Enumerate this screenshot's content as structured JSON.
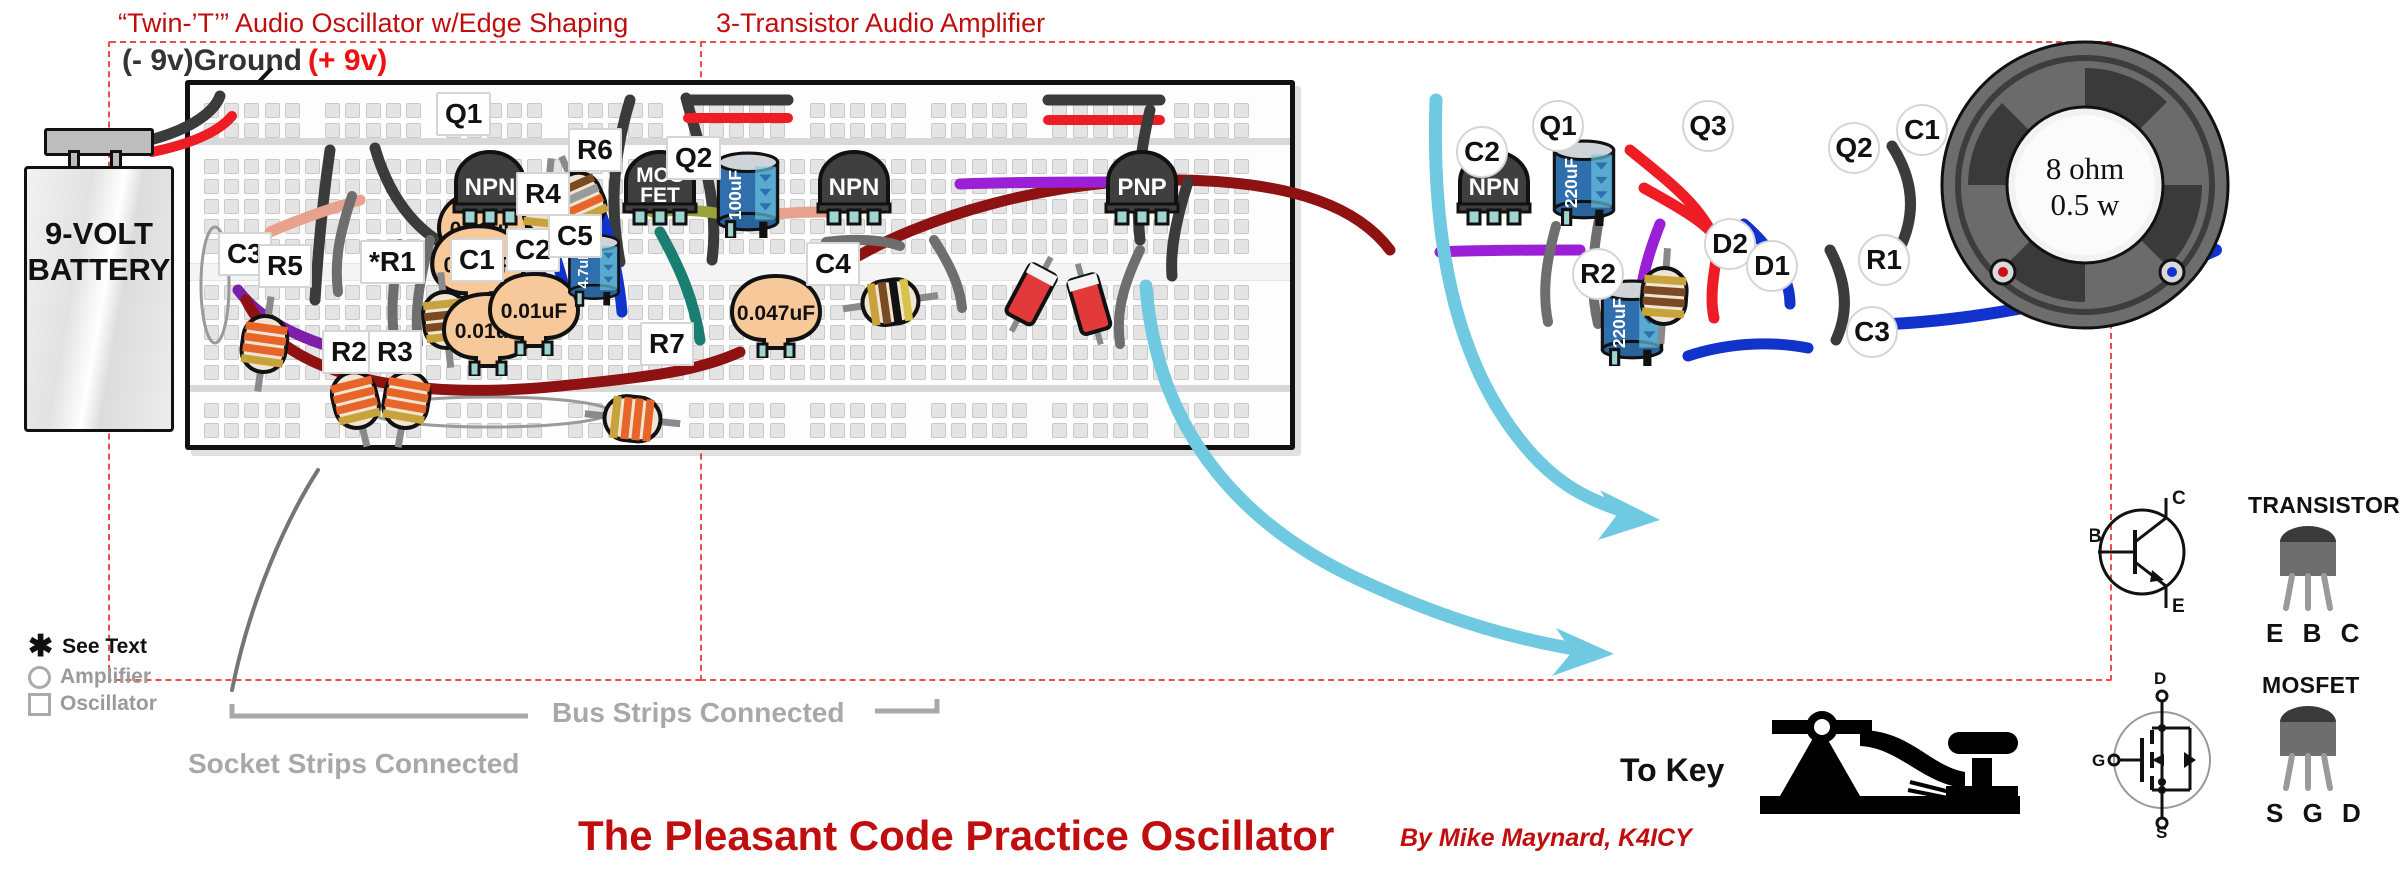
{
  "headings": {
    "oscillator_section": "“Twin-’T’” Audio Oscillator w/Edge Shaping",
    "amplifier_section": "3-Transistor Audio Amplifier",
    "ground_label": "(- 9v)Ground",
    "plus9_label": "(+ 9v)"
  },
  "battery": {
    "line1": "9-VOLT",
    "line2": "BATTERY"
  },
  "speaker": {
    "line1": "8 ohm",
    "line2": "0.5 w"
  },
  "oscillator_parts": [
    {
      "tag": "C3",
      "shape": "square"
    },
    {
      "tag": "Q1",
      "shape": "square"
    },
    {
      "tag": "R6",
      "shape": "square"
    },
    {
      "tag": "R4",
      "shape": "square"
    },
    {
      "tag": "Q2",
      "shape": "square"
    },
    {
      "tag": "R5",
      "shape": "square"
    },
    {
      "tag": "*R1",
      "shape": "square"
    },
    {
      "tag": "C1",
      "shape": "square"
    },
    {
      "tag": "C2",
      "shape": "square"
    },
    {
      "tag": "C5",
      "shape": "square"
    },
    {
      "tag": "C4",
      "shape": "square"
    },
    {
      "tag": "R2",
      "shape": "square"
    },
    {
      "tag": "R3",
      "shape": "square"
    },
    {
      "tag": "R7",
      "shape": "square"
    }
  ],
  "amplifier_parts": [
    {
      "tag": "C2",
      "shape": "circle"
    },
    {
      "tag": "Q1",
      "shape": "circle"
    },
    {
      "tag": "Q3",
      "shape": "circle"
    },
    {
      "tag": "Q2",
      "shape": "circle"
    },
    {
      "tag": "C1",
      "shape": "circle"
    },
    {
      "tag": "D2",
      "shape": "circle"
    },
    {
      "tag": "D1",
      "shape": "circle"
    },
    {
      "tag": "R1",
      "shape": "circle"
    },
    {
      "tag": "R2",
      "shape": "circle"
    },
    {
      "tag": "C3",
      "shape": "circle"
    }
  ],
  "component_values": {
    "c3_top": "0.01uF",
    "c3_bottom": "0.01uF",
    "osc_c1": "0.01uF",
    "osc_c2": "0.01uF",
    "osc_c5": "4.7uF",
    "osc_c4": "0.047uF",
    "amp_c2": "100uF",
    "amp_c1": "220uF",
    "amp_c3": "220uF"
  },
  "device_labels": {
    "npn": "NPN",
    "pnp": "PNP",
    "mosfet_line1": "MOS",
    "mosfet_line2": "FET"
  },
  "legend": {
    "see_text": "See Text",
    "see_text_marker": "✱",
    "amplifier": "Amplifier",
    "amplifier_marker": "circle",
    "oscillator": "Oscillator",
    "oscillator_marker": "square",
    "bus_strips": "Bus Strips Connected",
    "socket_strips": "Socket Strips Connected"
  },
  "pinouts": {
    "transistor_title": "TRANSISTOR",
    "transistor_pins": "E B C",
    "transistor_sym_c": "C",
    "transistor_sym_b": "B",
    "transistor_sym_e": "E",
    "mosfet_title": "MOSFET",
    "mosfet_pins": "S G D",
    "mosfet_sym_d": "D",
    "mosfet_sym_g": "G",
    "mosfet_sym_s": "S"
  },
  "to_key": "To Key",
  "footer": {
    "title": "The Pleasant Code Practice Oscillator",
    "byline": "By Mike Maynard, K4ICY"
  },
  "colors": {
    "section_red": "#c00d0d",
    "dash_red": "#ee4b4b",
    "plus9_red": "#ee1111",
    "gray_note": "#a8a8a8",
    "wire_black": "#3b3b3b",
    "wire_red": "#ee1c25",
    "wire_blue": "#1133cc",
    "wire_purple": "#9b1fd6",
    "wire_darkred": "#8f1212",
    "wire_teal": "#1fbfa0",
    "wire_lightblue": "#6fc9e0",
    "wire_salmon": "#e8a18c",
    "wire_olive": "#9aa23a",
    "wire_gray": "#6e6e6e",
    "cap_tan": "#f7c99a",
    "cap_blue": "#2f6fad"
  }
}
